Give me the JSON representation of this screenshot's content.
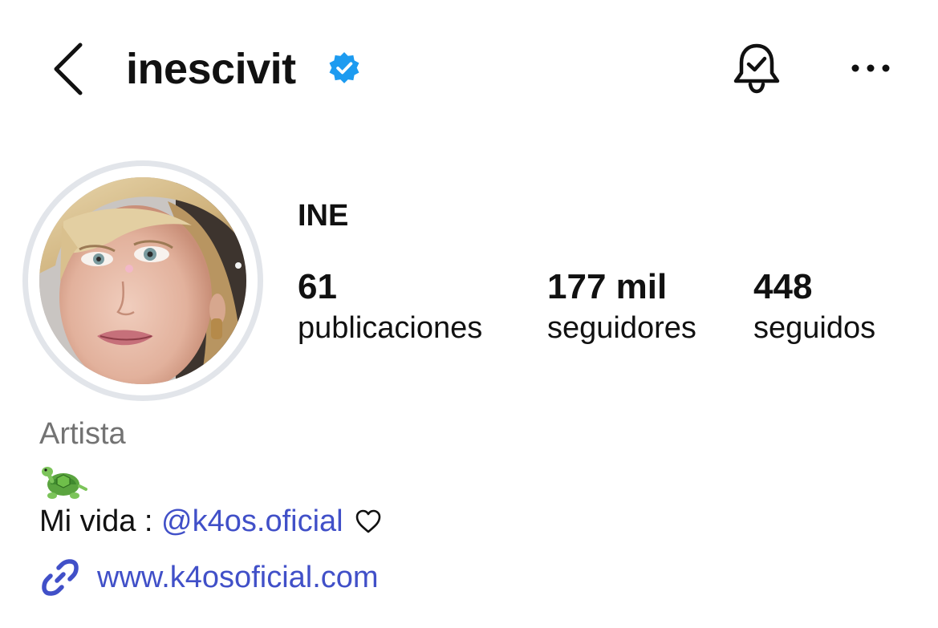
{
  "header": {
    "username": "inescivit",
    "icons": {
      "back": "chevron-left-icon",
      "verified": "verified-badge-icon",
      "notifications": "bell-check-icon",
      "more": "more-horizontal-icon"
    }
  },
  "profile": {
    "display_name": "INE",
    "stats": [
      {
        "value": "61",
        "label": "publicaciones"
      },
      {
        "value": "177 mil",
        "label": "seguidores"
      },
      {
        "value": "448",
        "label": "seguidos"
      }
    ],
    "category": "Artista",
    "bio_emoji": "turtle-emoji",
    "bio_prefix": "Mi vida : ",
    "bio_mention": "@k4os.oficial",
    "bio_suffix_icon": "heart-outline-icon",
    "link": "www.k4osoficial.com",
    "link_icon": "link-icon"
  },
  "colors": {
    "verified_blue": "#1d9bf0",
    "link_blue": "#4150c8",
    "category_gray": "#737373",
    "avatar_ring": "#e2e5ea"
  }
}
